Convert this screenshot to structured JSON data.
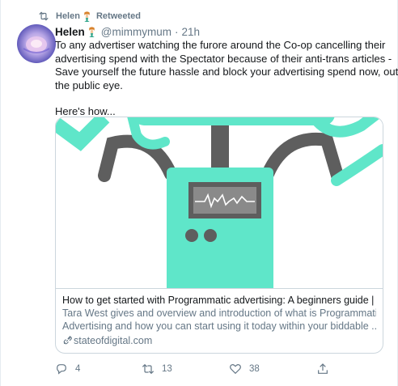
{
  "retweet_context": {
    "icon": "retweet-icon",
    "user": "Helen",
    "emoji": "mermaid-emoji",
    "label": "Retweeted"
  },
  "tweet": {
    "author_name": "Helen",
    "author_emoji": "mermaid-emoji",
    "handle": "@mimmymum",
    "separator": "·",
    "time": "21h",
    "text_lines": [
      "To any advertiser watching the furore around the Co-op cancelling their",
      "advertising spend with the Spectator because of their anti-trans articles -",
      "Save yourself the future hassle and block your advertising spend now, out of",
      "the public eye.",
      "Here's how..."
    ]
  },
  "card": {
    "title": "How to get started with Programmatic advertising: A beginners guide | ...",
    "description_lines": [
      "Tara West gives and overview and introduction of what is Programmatic",
      "Advertising and how you can start using it today within your biddable ..."
    ],
    "domain": "stateofdigital.com",
    "colors": {
      "robot": "#5fe6c9",
      "arms": "#5e5e5e",
      "screen": "#8a8a8a"
    }
  },
  "actions": {
    "reply": {
      "icon": "reply-icon",
      "count": "4"
    },
    "retweet": {
      "icon": "retweet-icon",
      "count": "13"
    },
    "like": {
      "icon": "heart-icon",
      "count": "38"
    },
    "share": {
      "icon": "share-icon",
      "count": ""
    }
  },
  "colors": {
    "secondary_text": "#657786",
    "primary_text": "#14171a",
    "border": "#ccd6dd"
  }
}
